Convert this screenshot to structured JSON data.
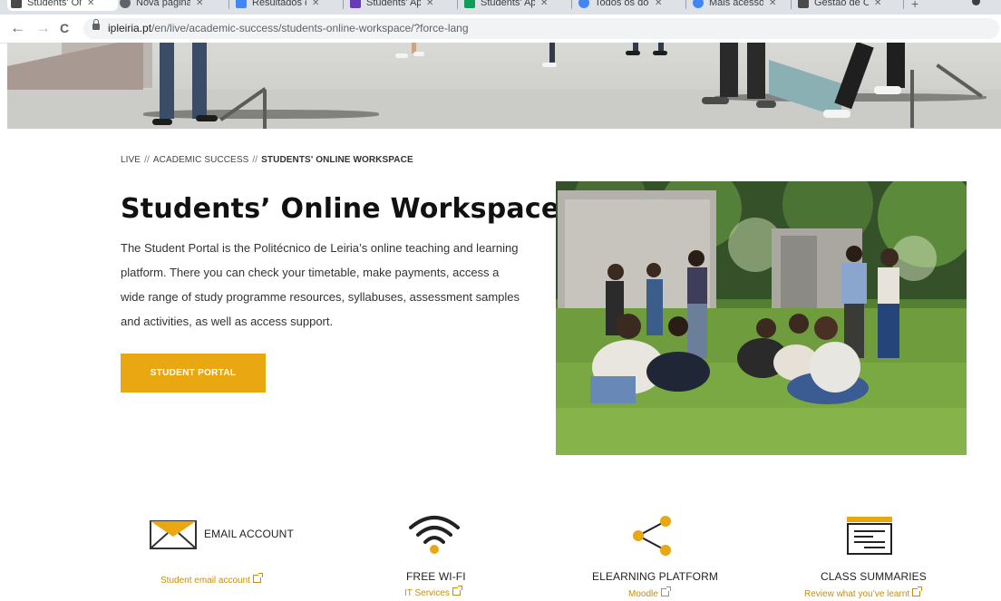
{
  "browser": {
    "tabs": [
      {
        "title": "Students' Onl",
        "fav": "#4a4a4a",
        "active": true
      },
      {
        "title": "Nova página",
        "fav": "#5f6368"
      },
      {
        "title": "Resultados da",
        "fav": "#4285f4"
      },
      {
        "title": "Students' App",
        "fav": "#673ab7"
      },
      {
        "title": "Students' App",
        "fav": "#0f9d58"
      },
      {
        "title": "Todos os docu",
        "fav": "#4285f4"
      },
      {
        "title": "Mais acessos,",
        "fav": "#4285f4"
      },
      {
        "title": "Gestão de Cli",
        "fav": "#4a4a4a"
      }
    ],
    "url_host": "ipleiria.pt",
    "url_path": "/en/live/academic-success/students-online-workspace/?force-lang",
    "back_icon": "←",
    "forward_icon": "→",
    "reload_icon": "C"
  },
  "breadcrumb": {
    "items": [
      "LIVE",
      "ACADEMIC SUCCESS"
    ],
    "separator": "//",
    "current": "STUDENTS' ONLINE WORKSPACE"
  },
  "page": {
    "title": "Students’ Online Workspace",
    "intro": "The Student Portal is the Politécnico de Leiria’s online teaching and learning platform. There you can check your timetable, make payments, access a wide range of study programme resources, syllabuses, assessment samples and activities, as well as access support.",
    "cta_label": "STUDENT PORTAL"
  },
  "colors": {
    "accent": "#e9a712",
    "link": "#c98e07"
  },
  "features": [
    {
      "icon": "envelope-icon",
      "title": "EMAIL ACCOUNT",
      "link": "Student email account"
    },
    {
      "icon": "wifi-icon",
      "title": "FREE WI-FI",
      "link": "IT Services"
    },
    {
      "icon": "share-icon",
      "title": "ELEARNING PLATFORM",
      "link": "Moodle"
    },
    {
      "icon": "class-summary-icon",
      "title": "CLASS SUMMARIES",
      "link": "Review what you’ve learnt"
    }
  ]
}
